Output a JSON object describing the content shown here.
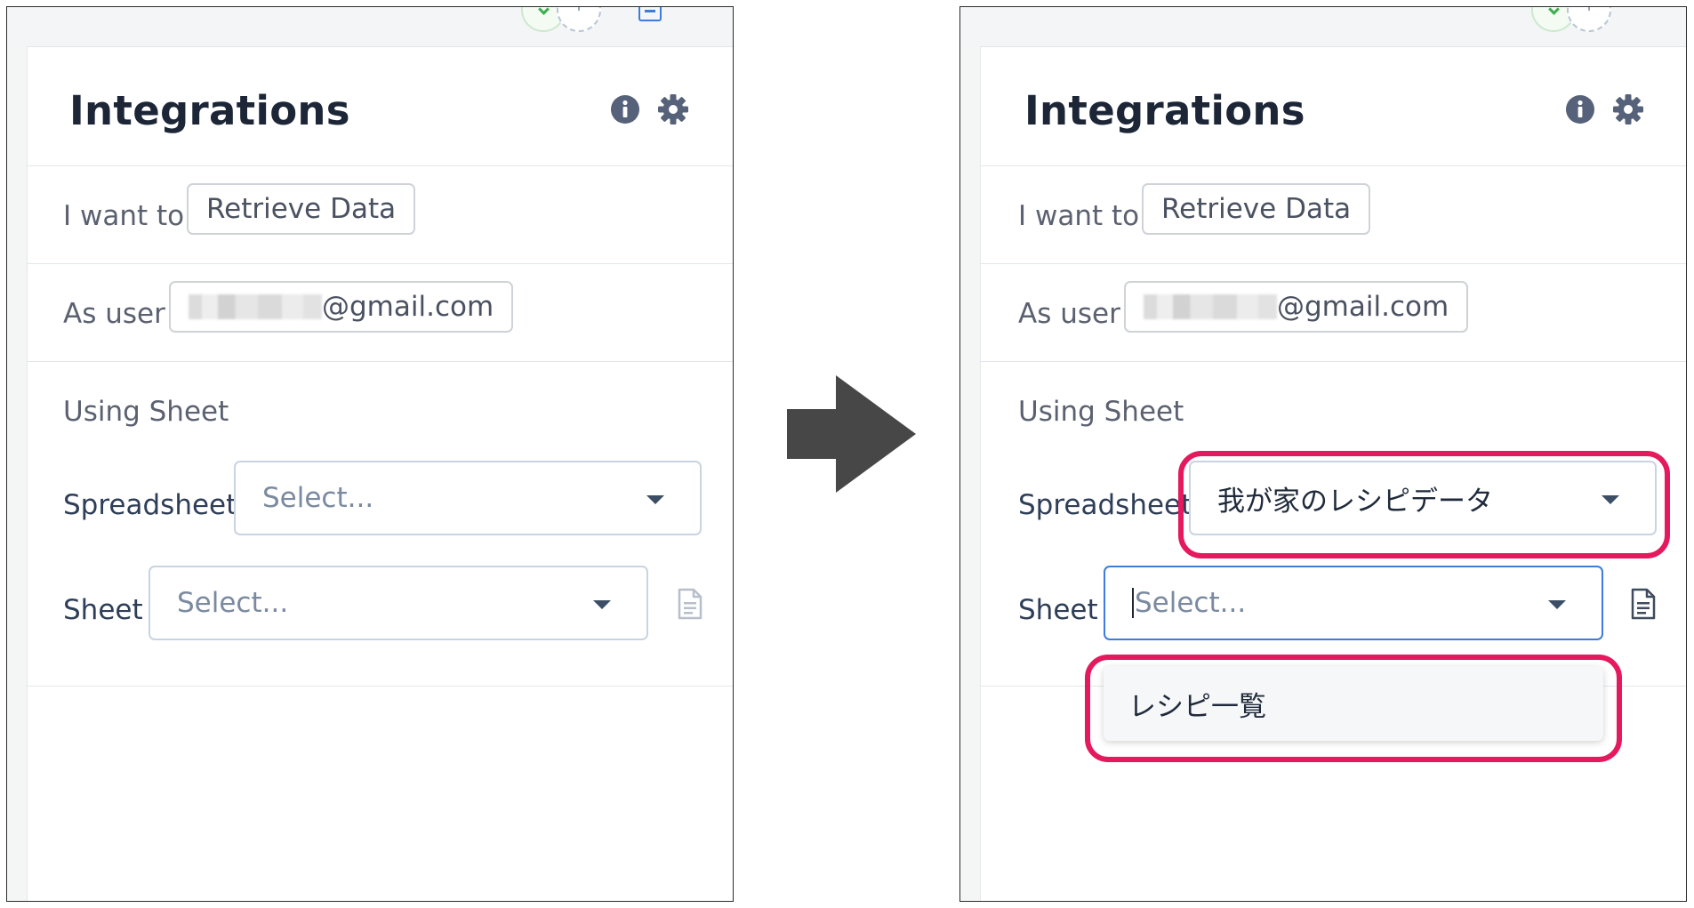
{
  "panels": [
    {
      "title": "Integrations",
      "action": {
        "prefix": "I want to",
        "value": "Retrieve Data"
      },
      "user": {
        "prefix": "As user",
        "email_suffix": "@gmail.com"
      },
      "using_sheet": "Using Sheet",
      "spreadsheet": {
        "label": "Spreadsheet",
        "value": "Select..."
      },
      "sheet": {
        "label": "Sheet",
        "value": "Select..."
      }
    },
    {
      "title": "Integrations",
      "action": {
        "prefix": "I want to",
        "value": "Retrieve Data"
      },
      "user": {
        "prefix": "As user",
        "email_suffix": "@gmail.com"
      },
      "using_sheet": "Using Sheet",
      "spreadsheet": {
        "label": "Spreadsheet",
        "value": "我が家のレシピデータ"
      },
      "sheet": {
        "label": "Sheet",
        "value": "Select..."
      },
      "sheet_options": [
        "レシピ一覧"
      ]
    }
  ],
  "colors": {
    "accent": "#3c7ddb",
    "highlight": "#e5195d",
    "title": "#1c2637"
  },
  "icons": [
    "info-icon",
    "gear-icon",
    "document-icon",
    "chevron-down-icon",
    "arrow-right-icon"
  ]
}
